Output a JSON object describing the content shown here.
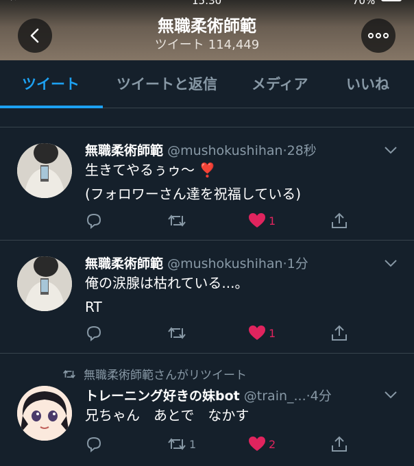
{
  "status_bar": {
    "time": "15:30",
    "battery": "70%"
  },
  "header": {
    "title": "無職柔術師範",
    "subtitle_label": "ツイート",
    "subtitle_count": "114,449"
  },
  "tabs": [
    "ツイート",
    "ツイートと返信",
    "メディア",
    "いいね"
  ],
  "tweets": [
    {
      "name": "無職柔術師範",
      "handle": "@mushokushihan",
      "time": "·28秒",
      "lines": [
        "生きてやるぅゥ〜 ❣️",
        "(フォロワーさん達を祝福している)"
      ],
      "likes": "1",
      "retweets": ""
    },
    {
      "name": "無職柔術師範",
      "handle": "@mushokushihan",
      "time": "·1分",
      "lines": [
        "俺の涙腺は枯れている...。",
        "RT"
      ],
      "likes": "1",
      "retweets": ""
    },
    {
      "retweeted_by": "無職柔術師範さんがリツイート",
      "name": "トレーニング好きの妹bot",
      "handle": "@train_...",
      "time": "·4分",
      "lines": [
        "兄ちゃん　あとで　なかす"
      ],
      "likes": "2",
      "retweets": "1"
    }
  ],
  "colors": {
    "accent": "#1da1f2",
    "like": "#e0245e",
    "background": "#15202b",
    "muted": "#8899a6"
  }
}
